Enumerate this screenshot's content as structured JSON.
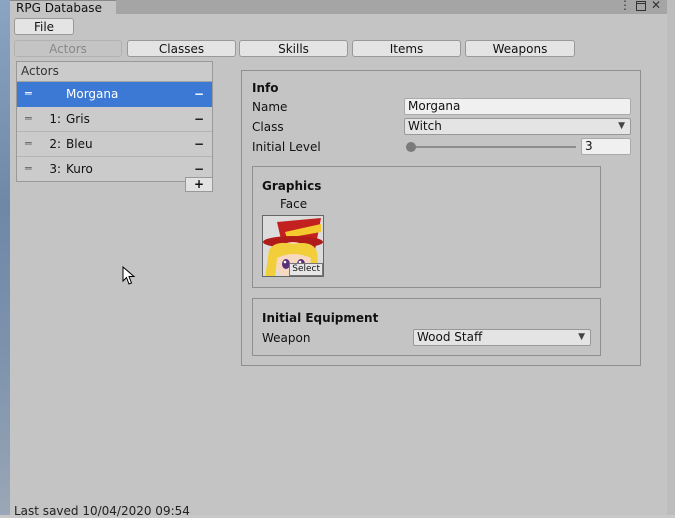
{
  "window": {
    "title": "RPG Database",
    "menu_icon": "kebab-menu-icon",
    "maximize_icon": "maximize-icon",
    "close_icon": "close-icon"
  },
  "toolbar": {
    "file_label": "File"
  },
  "tabs": [
    {
      "label": "Actors",
      "active": true
    },
    {
      "label": "Classes",
      "active": false
    },
    {
      "label": "Skills",
      "active": false
    },
    {
      "label": "Items",
      "active": false
    },
    {
      "label": "Weapons",
      "active": false
    }
  ],
  "actor_list": {
    "header": "Actors",
    "items": [
      {
        "index": "",
        "name": "Morgana",
        "selected": true
      },
      {
        "index": "1:",
        "name": "Gris",
        "selected": false
      },
      {
        "index": "2:",
        "name": "Bleu",
        "selected": false
      },
      {
        "index": "3:",
        "name": "Kuro",
        "selected": false
      }
    ],
    "drag_icon": "drag-handle-icon",
    "remove_symbol": "−",
    "add_symbol": "+"
  },
  "info": {
    "title": "Info",
    "name_label": "Name",
    "name_value": "Morgana",
    "class_label": "Class",
    "class_value": "Witch",
    "level_label": "Initial Level",
    "level_value": "3"
  },
  "graphics": {
    "title": "Graphics",
    "face_label": "Face",
    "select_label": "Select"
  },
  "equipment": {
    "title": "Initial Equipment",
    "weapon_label": "Weapon",
    "weapon_value": "Wood Staff"
  },
  "status": {
    "text": "Last saved 10/04/2020 09:54"
  },
  "colors": {
    "selection": "#3c79d4",
    "window_bg": "#c4c4c4"
  }
}
